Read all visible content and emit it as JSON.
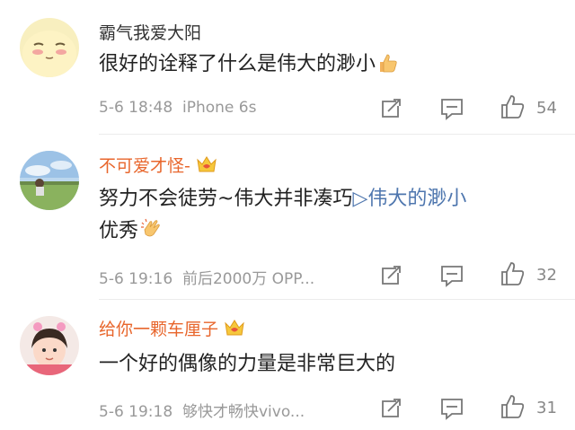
{
  "comments": [
    {
      "username": "霸气我爱大阳",
      "text": "很好的诠释了什么是伟大的渺小",
      "emoji": "thumbs-up-emoji",
      "time": "5-6 18:48",
      "device": "iPhone 6s",
      "likes": "54"
    },
    {
      "username": "不可爱才怪-",
      "text_before": "努力不会徒劳~伟大并非凑巧",
      "link": "▷伟大的渺小",
      "text_line2": "优秀",
      "emoji": "clapping-hands-emoji",
      "time": "5-6 19:16",
      "device": "前后2000万 OPP...",
      "likes": "32"
    },
    {
      "username": "给你一颗车厘子",
      "text": "一个好的偶像的力量是非常巨大的",
      "time": "5-6 19:18",
      "device": "够快才畅快vivo...",
      "likes": "31"
    }
  ],
  "colors": {
    "username_vip": "#e8662c",
    "link": "#4e76ae",
    "meta": "#999999"
  }
}
